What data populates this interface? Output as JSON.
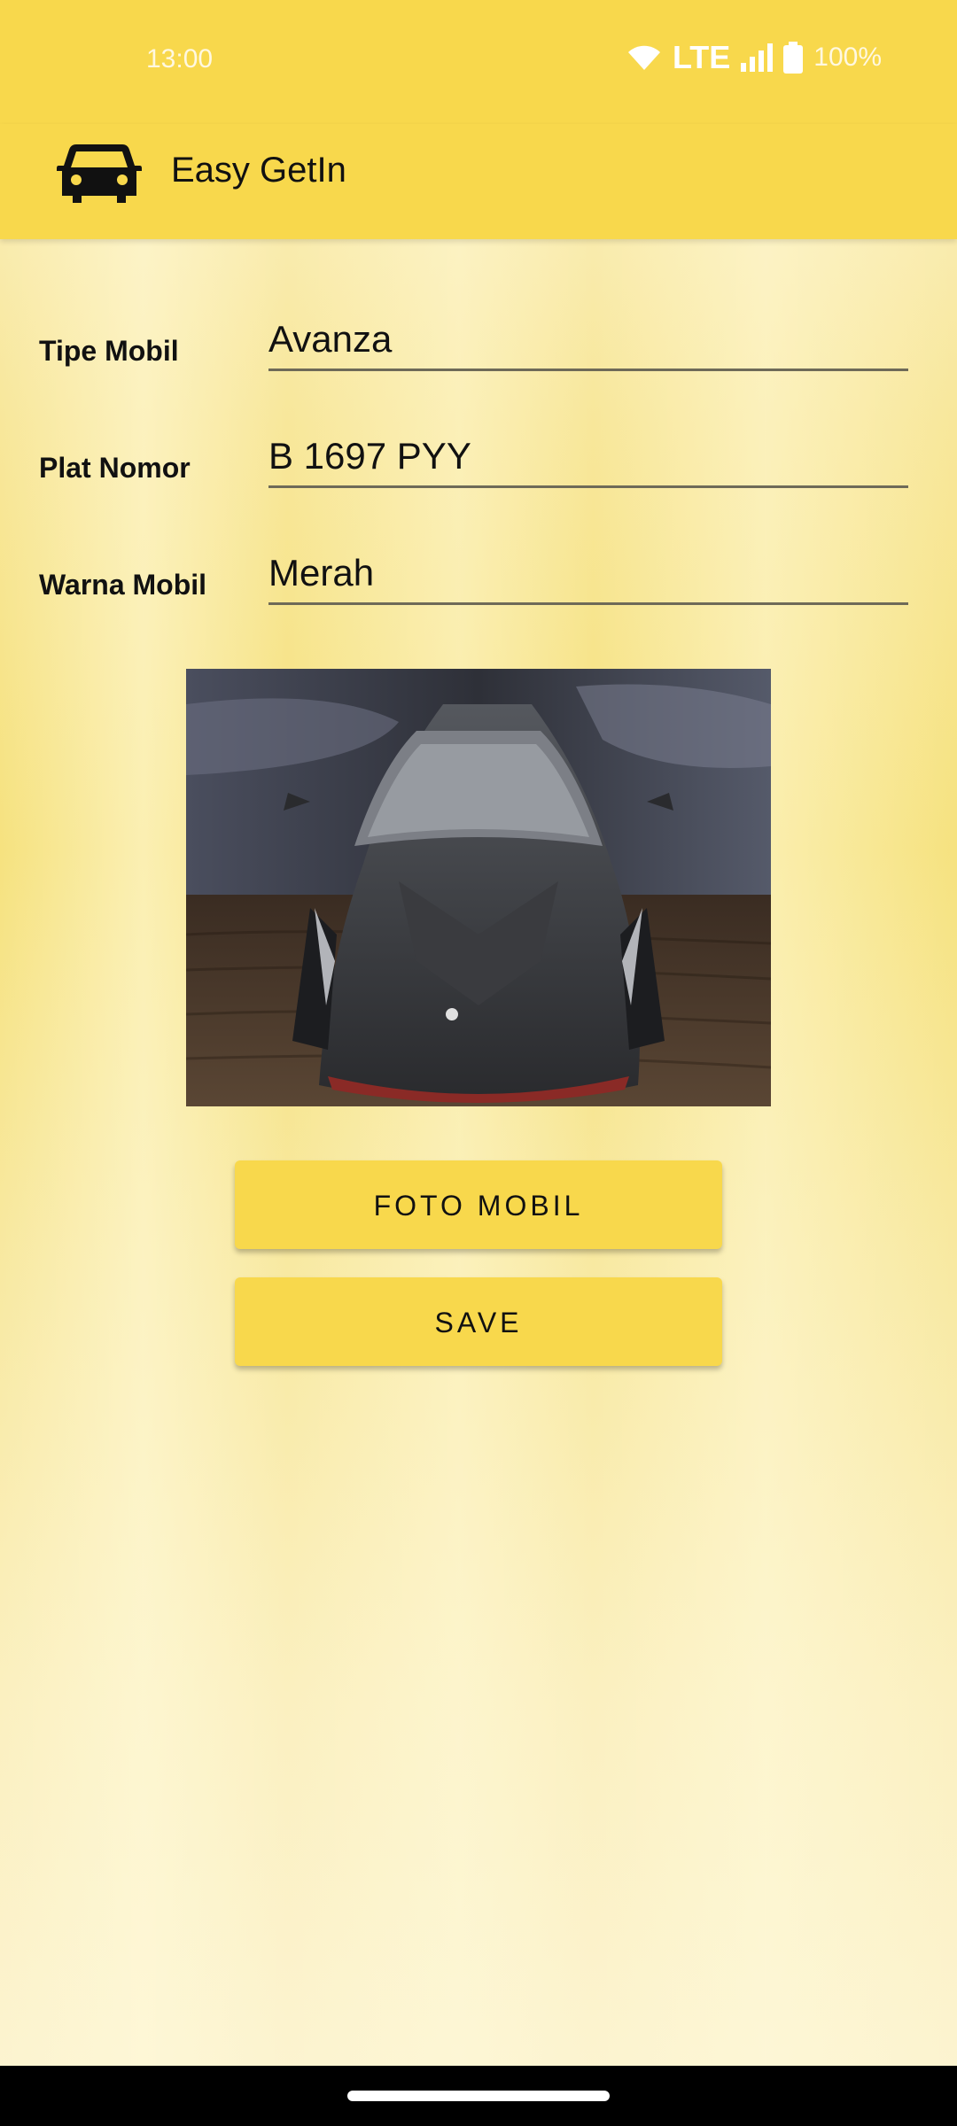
{
  "status_bar": {
    "time": "13:00",
    "network": "LTE",
    "battery": "100%"
  },
  "app_bar": {
    "icon": "car-icon",
    "title": "Easy GetIn"
  },
  "form": {
    "tipe_mobil": {
      "label": "Tipe Mobil",
      "value": "Avanza"
    },
    "plat_nomor": {
      "label": "Plat Nomor",
      "value": "B 1697 PYY"
    },
    "warna_mobil": {
      "label": "Warna Mobil",
      "value": "Merah"
    }
  },
  "photo": {
    "subject": "car-photo"
  },
  "buttons": {
    "foto_mobil": "FOTO MOBIL",
    "save": "SAVE"
  },
  "colors": {
    "primary": "#f8d84c",
    "background": "#f7e9a0",
    "text": "#111111",
    "nav_bar": "#000000"
  }
}
